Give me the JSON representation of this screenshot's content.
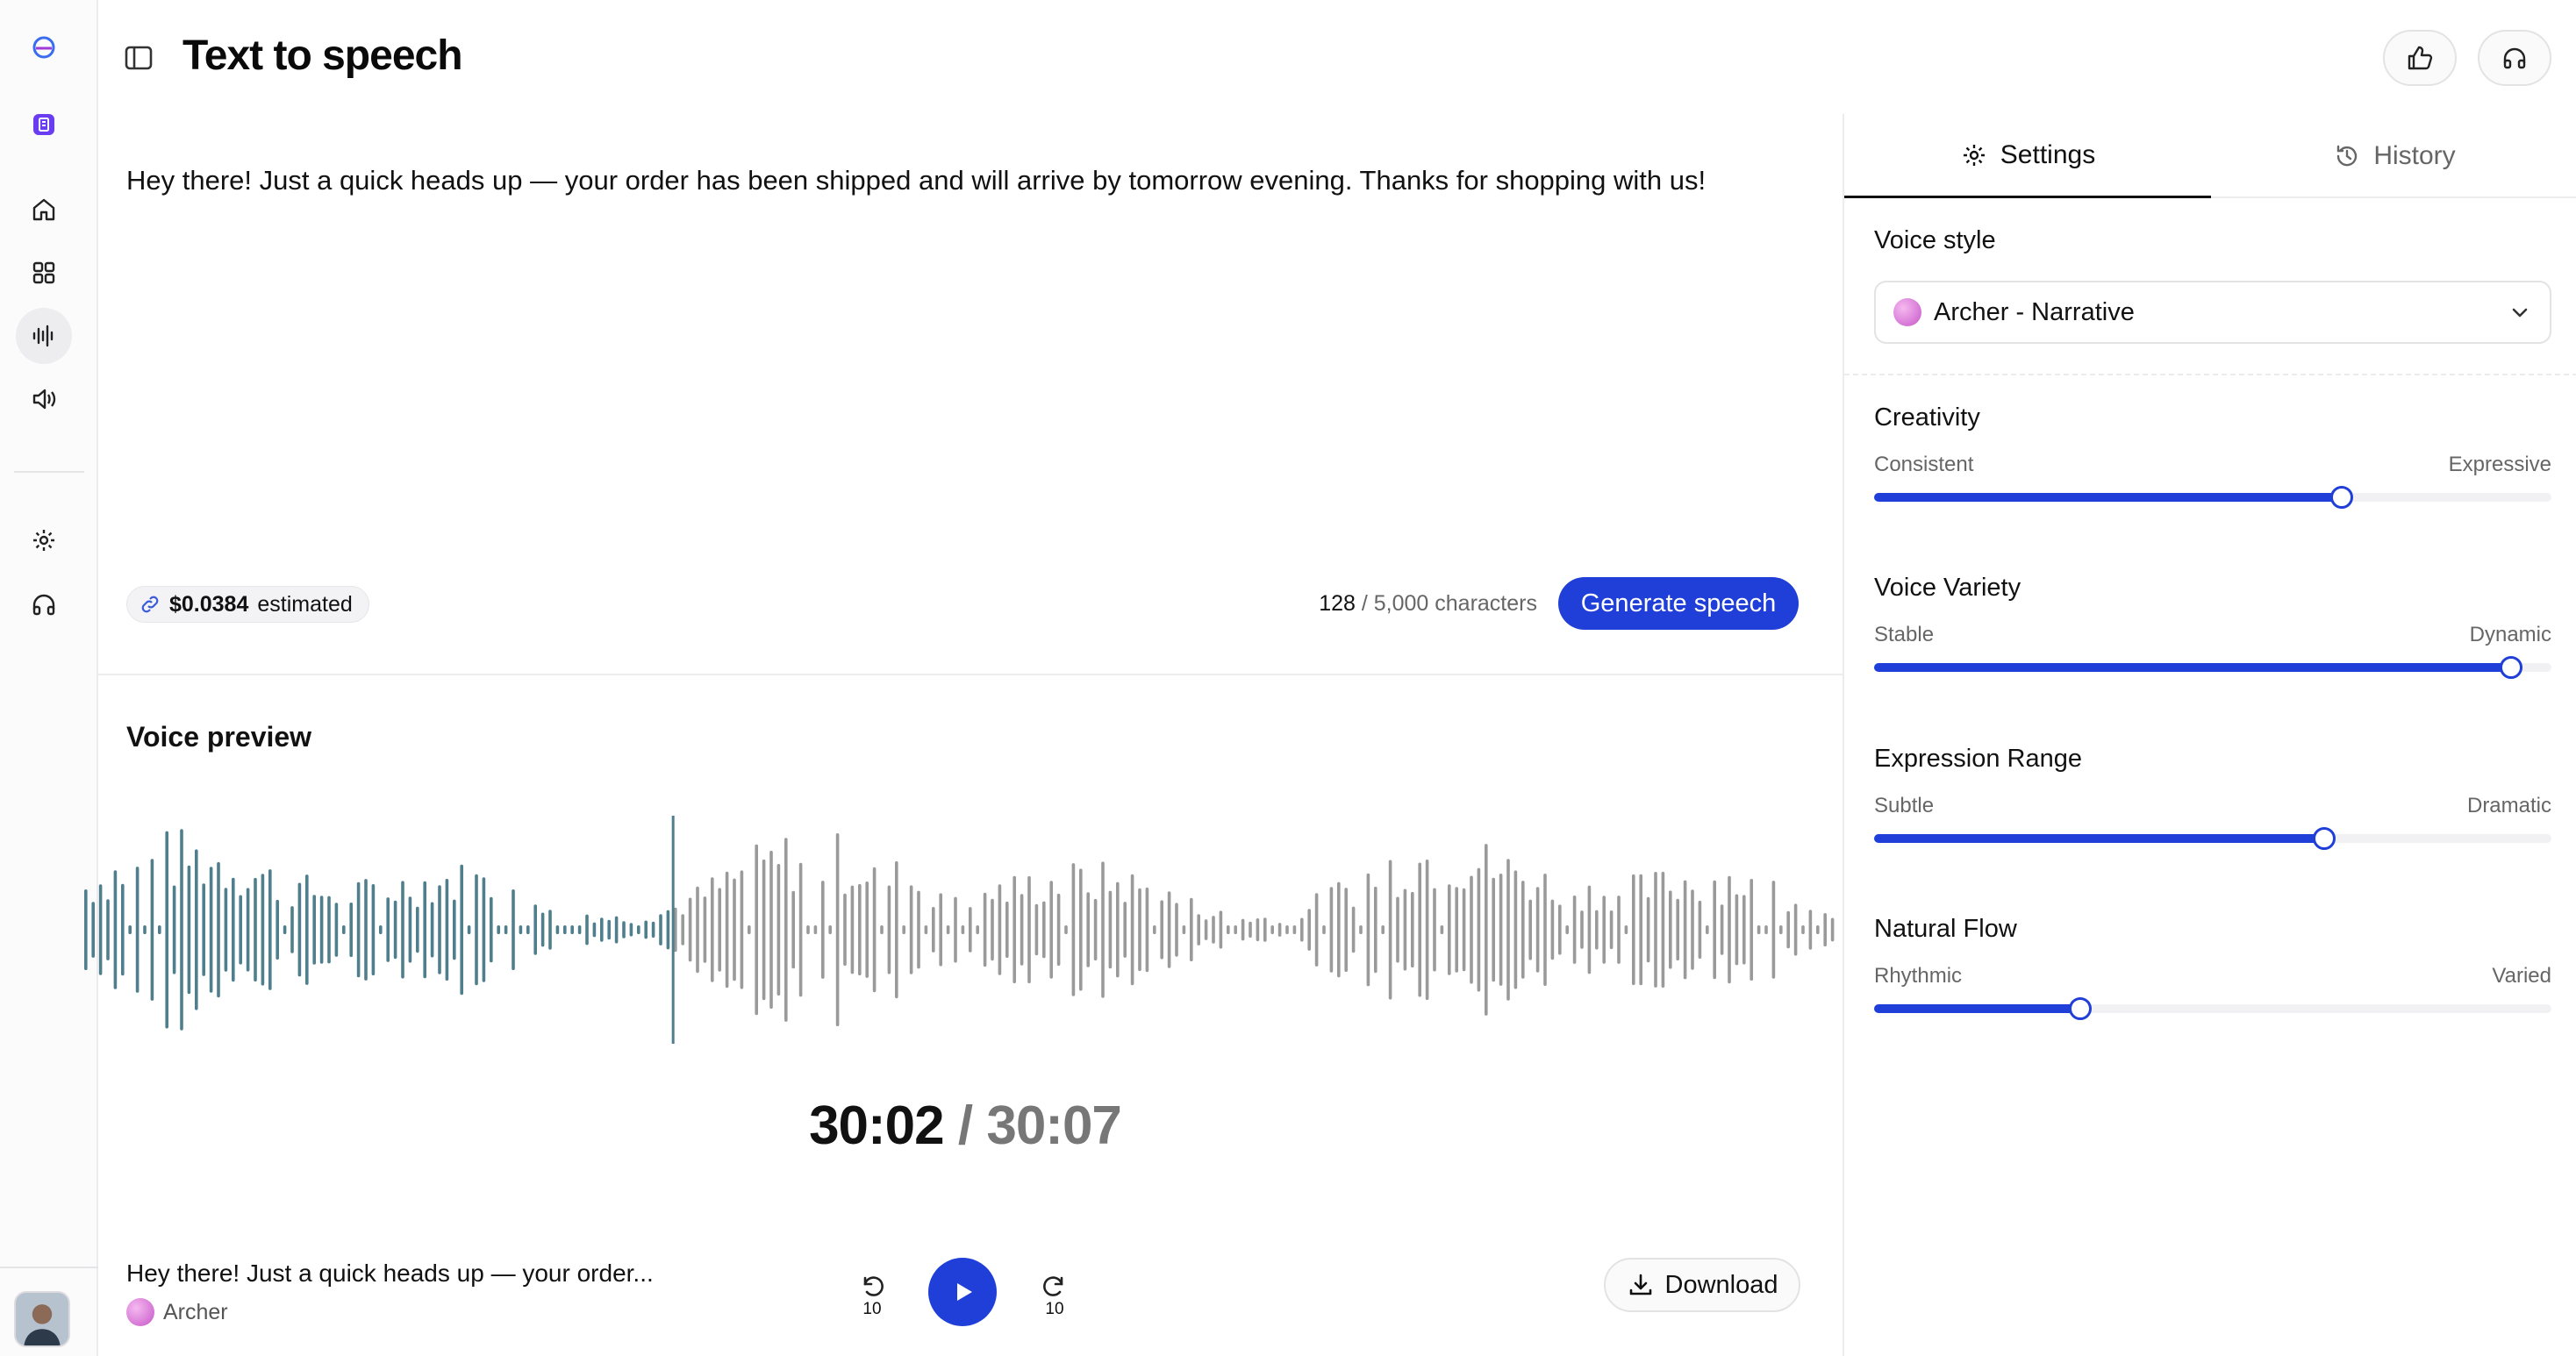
{
  "header": {
    "title": "Text to speech"
  },
  "editor": {
    "text": "Hey there! Just a quick heads up — your order has been shipped and will arrive by tomorrow evening. Thanks for shopping with us!",
    "cost": "$0.0384",
    "cost_suffix": "estimated",
    "char_count": "128",
    "char_limit": "/ 5,000 characters",
    "generate_label": "Generate speech"
  },
  "preview": {
    "title": "Voice preview",
    "time_current": "30:02",
    "time_separator": "/",
    "time_total": "30:07",
    "track_title": "Hey there! Just a quick heads up — your order...",
    "voice_name": "Archer",
    "skip_back_seconds": "10",
    "skip_forward_seconds": "10",
    "download_label": "Download",
    "played_color": "#4f7f8c",
    "unplayed_color": "#9a9a9a",
    "progress_fraction": 0.335
  },
  "panel": {
    "tabs": [
      {
        "label": "Settings",
        "icon": "gear-icon",
        "active": true
      },
      {
        "label": "History",
        "icon": "history-icon",
        "active": false
      }
    ],
    "voice_style_label": "Voice style",
    "voice_style_value": "Archer - Narrative",
    "sliders": [
      {
        "label": "Creativity",
        "min_label": "Consistent",
        "max_label": "Expressive",
        "value": 0.69
      },
      {
        "label": "Voice Variety",
        "min_label": "Stable",
        "max_label": "Dynamic",
        "value": 0.94
      },
      {
        "label": "Expression Range",
        "min_label": "Subtle",
        "max_label": "Dramatic",
        "value": 0.665
      },
      {
        "label": "Natural Flow",
        "min_label": "Rhythmic",
        "max_label": "Varied",
        "value": 0.305
      }
    ]
  },
  "rail": {
    "items": [
      "logo-icon",
      "workspace-icon",
      "home-icon",
      "grid-icon",
      "waveform-icon",
      "speaker-icon",
      "settings-icon",
      "headphones-icon"
    ]
  },
  "colors": {
    "accent": "#1f3fd8"
  }
}
